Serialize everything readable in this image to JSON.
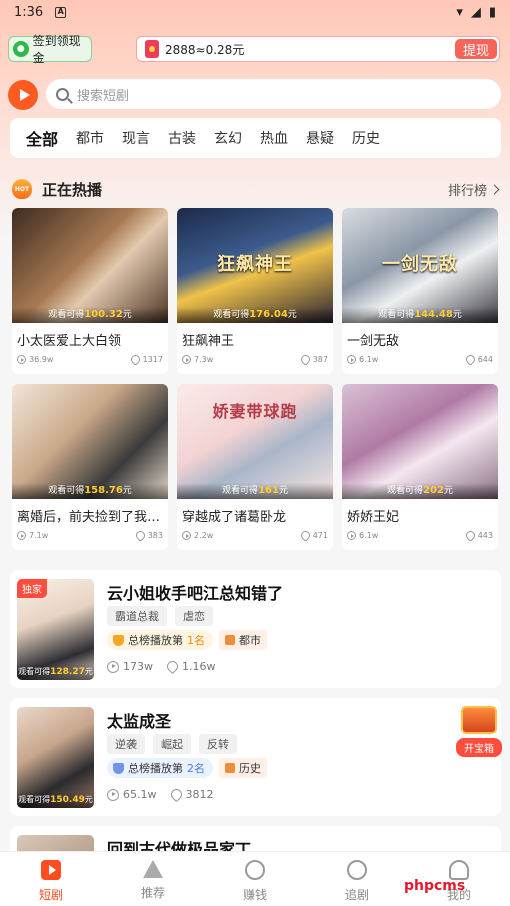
{
  "status": {
    "time": "1:36",
    "a_icon": "A"
  },
  "top": {
    "signin_label": "签到领现金",
    "coins_text": "2888≈0.28元",
    "withdraw_label": "提现",
    "search_placeholder": "搜索短剧"
  },
  "categories": [
    "全部",
    "都市",
    "现言",
    "古装",
    "玄幻",
    "热血",
    "悬疑",
    "历史"
  ],
  "hot": {
    "icon_text": "HOT",
    "title": "正在热播",
    "rank_link": "排行榜",
    "earn_prefix": "观看可得",
    "earn_suffix": "元",
    "items": [
      {
        "title": "小太医爱上大白领",
        "cover_text": "",
        "earn": "100.32",
        "plays": "36.9w",
        "likes": "1317"
      },
      {
        "title": "狂飙神王",
        "cover_text": "狂飙神王",
        "earn": "176.04",
        "plays": "7.3w",
        "likes": "387"
      },
      {
        "title": "一剑无敌",
        "cover_text": "一剑无敌",
        "earn": "144.48",
        "plays": "6.1w",
        "likes": "644"
      },
      {
        "title": "离婚后，前夫捡到了我的...",
        "cover_text": "",
        "earn": "158.76",
        "plays": "7.1w",
        "likes": "383"
      },
      {
        "title": "穿越成了诸葛卧龙",
        "cover_text": "娇妻带球跑",
        "earn": "161",
        "plays": "2.2w",
        "likes": "471"
      },
      {
        "title": "娇娇王妃",
        "cover_text": "",
        "earn": "202",
        "plays": "6.1w",
        "likes": "443"
      }
    ]
  },
  "list": [
    {
      "badge": "独家",
      "title": "云小姐收手吧江总知错了",
      "tags": [
        "霸道总裁",
        "虐恋"
      ],
      "rank_text": "总榜播放第",
      "rank_num": "1名",
      "genre": "都市",
      "earn": "128.27",
      "plays": "173w",
      "likes": "1.16w"
    },
    {
      "badge": "",
      "title": "太监成圣",
      "tags": [
        "逆袭",
        "崛起",
        "反转"
      ],
      "rank_text": "总榜播放第",
      "rank_num": "2名",
      "genre": "历史",
      "earn": "150.49",
      "plays": "65.1w",
      "likes": "3812"
    },
    {
      "title": "回到古代做极品家丁"
    }
  ],
  "treasure_label": "开宝箱",
  "tabs": [
    "短剧",
    "推荐",
    "赚钱",
    "追剧",
    "我的"
  ],
  "watermark": "phpcms",
  "colors": {
    "accent": "#ff4d1f",
    "gold": "#ffcc33",
    "red": "#ff4d3d"
  }
}
